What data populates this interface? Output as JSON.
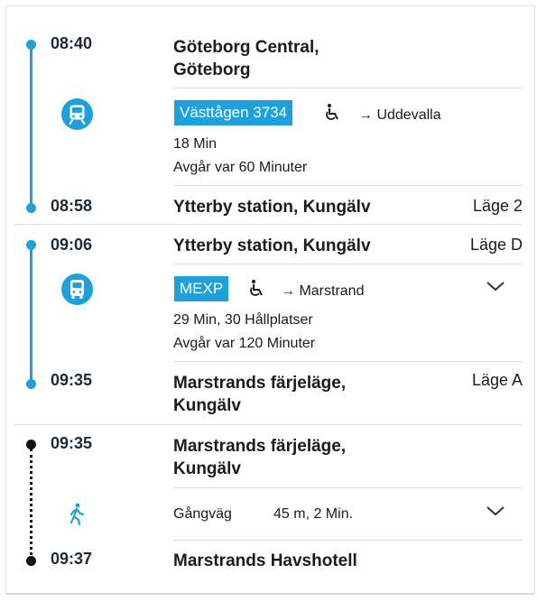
{
  "colors": {
    "accent": "#1ea0dc",
    "text": "#1b1b1b",
    "divider": "#dedede"
  },
  "legs": [
    {
      "mode": "train",
      "icon": "train-icon",
      "departure": {
        "time": "08:40",
        "stop_line1": "Göteborg Central,",
        "stop_line2": "Göteborg"
      },
      "line_name": "Västtågen 3734",
      "accessible_icon": "wheelchair-icon",
      "direction": "→ Uddevalla",
      "duration": "18 Min",
      "frequency": "Avgår var 60 Minuter",
      "arrival": {
        "time": "08:58",
        "stop": "Ytterby station, Kungälv",
        "track": "Läge 2"
      }
    },
    {
      "mode": "bus",
      "icon": "bus-icon",
      "departure": {
        "time": "09:06",
        "stop": "Ytterby station, Kungälv",
        "track": "Läge D"
      },
      "line_name": "MEXP",
      "accessible_icon": "wheelchair-icon",
      "direction": "→ Marstrand",
      "duration": "29 Min, 30 Hållplatser",
      "frequency": "Avgår var 120 Minuter",
      "arrival": {
        "time": "09:35",
        "stop_line1": "Marstrands färjeläge,",
        "stop_line2": "Kungälv",
        "track": "Läge A"
      }
    },
    {
      "mode": "walk",
      "icon": "walking-person-icon",
      "departure": {
        "time": "09:35",
        "stop_line1": "Marstrands färjeläge,",
        "stop_line2": "Kungälv"
      },
      "label": "Gångväg",
      "distance": "45 m, 2 Min.",
      "arrival": {
        "time": "09:37",
        "stop": "Marstrands Havshotell"
      }
    }
  ]
}
